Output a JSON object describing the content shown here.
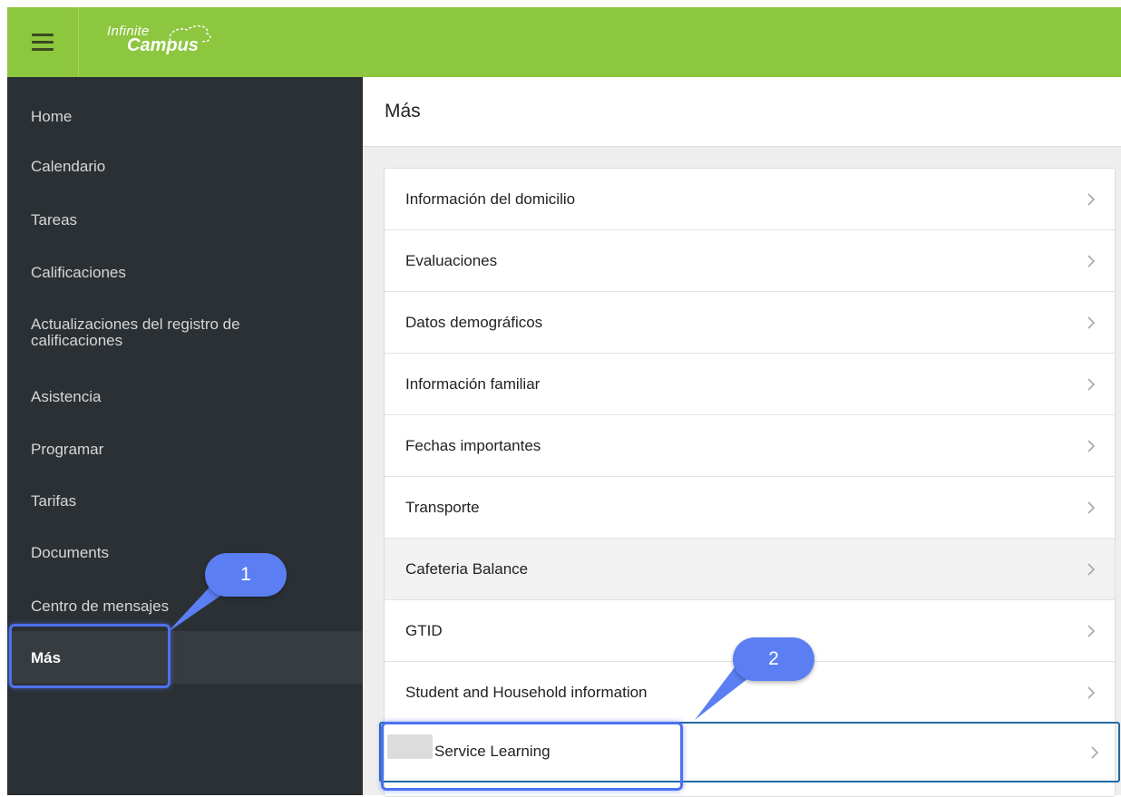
{
  "app": {
    "logo_line1": "Infinite",
    "logo_line2": "Campus"
  },
  "sidebar": {
    "items": [
      {
        "label": "Home"
      },
      {
        "label": "Calendario"
      },
      {
        "label": "Tareas"
      },
      {
        "label": "Calificaciones"
      },
      {
        "label": "Actualizaciones del registro de calificaciones"
      },
      {
        "label": "Asistencia"
      },
      {
        "label": "Programar"
      },
      {
        "label": "Tarifas"
      },
      {
        "label": "Documents"
      },
      {
        "label": "Centro de mensajes"
      },
      {
        "label": "Más"
      }
    ],
    "active": "Más"
  },
  "main": {
    "title": "Más",
    "items": [
      {
        "label": "Información del domicilio"
      },
      {
        "label": "Evaluaciones"
      },
      {
        "label": "Datos demográficos"
      },
      {
        "label": "Información familiar"
      },
      {
        "label": "Fechas importantes"
      },
      {
        "label": "Transporte"
      },
      {
        "label": "Cafeteria Balance"
      },
      {
        "label": "GTID"
      },
      {
        "label": "Student and Household information"
      },
      {
        "label": "Service Learning"
      }
    ]
  },
  "annotations": [
    {
      "number": "1"
    },
    {
      "number": "2"
    }
  ],
  "colors": {
    "accent": "#8dc63f",
    "sidebar": "#2b3034",
    "callout": "#5b7ff2",
    "selected_border": "#1f6aa5"
  }
}
